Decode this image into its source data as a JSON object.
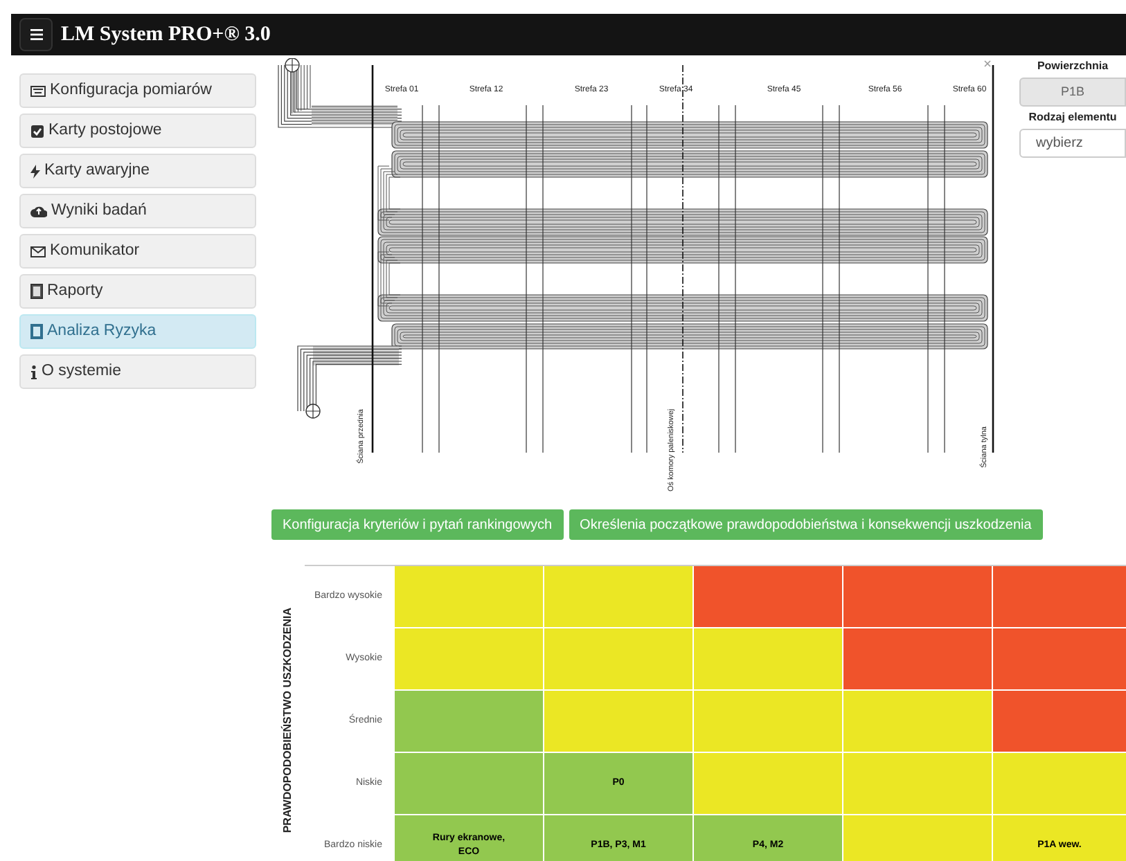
{
  "header": {
    "title": "LM System PRO+® 3.0"
  },
  "sidebar": {
    "items": [
      {
        "label": "Konfiguracja pomiarów",
        "selected": false
      },
      {
        "label": "Karty postojowe",
        "selected": false
      },
      {
        "label": "Karty awaryjne",
        "selected": false
      },
      {
        "label": "Wyniki badań",
        "selected": false
      },
      {
        "label": "Komunikator",
        "selected": false
      },
      {
        "label": "Raporty",
        "selected": false
      },
      {
        "label": "Analiza Ryzyka",
        "selected": true
      },
      {
        "label": "O systemie",
        "selected": false
      }
    ]
  },
  "drawing": {
    "zone_labels": [
      "Strefa 01",
      "Strefa 12",
      "Strefa 23",
      "Strefa 34",
      "Strefa 45",
      "Strefa 56",
      "Strefa 60"
    ],
    "wall_labels": [
      "Ściana przednia",
      "Oś komory paleniskowej",
      "Ściana tylna"
    ]
  },
  "panel": {
    "surface_label": "Powierzchnia",
    "surface_value": "P1B",
    "element_label": "Rodzaj elementu",
    "element_value": "wybierz"
  },
  "buttons": [
    "Konfiguracja kryteriów i pytań rankingowych",
    "Określenia początkowe prawdopodobieństwa i konsekwencji uszkodzenia"
  ],
  "risk_matrix": {
    "axis_title": "PRAWDOPODOBIEŃSTWO USZKODZENIA",
    "rows": [
      {
        "label": "Bardzo wysokie",
        "cells": [
          {
            "color": "#ebe724"
          },
          {
            "color": "#ebe724"
          },
          {
            "color": "#f0532b"
          },
          {
            "color": "#f0532b"
          },
          {
            "color": "#f0532b"
          }
        ]
      },
      {
        "label": "Wysokie",
        "cells": [
          {
            "color": "#ebe724"
          },
          {
            "color": "#ebe724"
          },
          {
            "color": "#ebe724"
          },
          {
            "color": "#f0532b"
          },
          {
            "color": "#f0532b"
          }
        ]
      },
      {
        "label": "Średnie",
        "cells": [
          {
            "color": "#92c84f"
          },
          {
            "color": "#ebe724"
          },
          {
            "color": "#ebe724"
          },
          {
            "color": "#ebe724"
          },
          {
            "color": "#f0532b"
          }
        ]
      },
      {
        "label": "Niskie",
        "cells": [
          {
            "color": "#92c84f"
          },
          {
            "color": "#92c84f",
            "text": "P0"
          },
          {
            "color": "#ebe724"
          },
          {
            "color": "#ebe724"
          },
          {
            "color": "#ebe724"
          }
        ]
      },
      {
        "label": "Bardzo niskie",
        "cells": [
          {
            "color": "#92c84f",
            "text": "Rury ekranowe, ECO"
          },
          {
            "color": "#92c84f",
            "text": "P1B, P3, M1"
          },
          {
            "color": "#92c84f",
            "text": "P4, M2"
          },
          {
            "color": "#ebe724"
          },
          {
            "color": "#ebe724",
            "text": "P1A wew."
          }
        ]
      }
    ]
  }
}
